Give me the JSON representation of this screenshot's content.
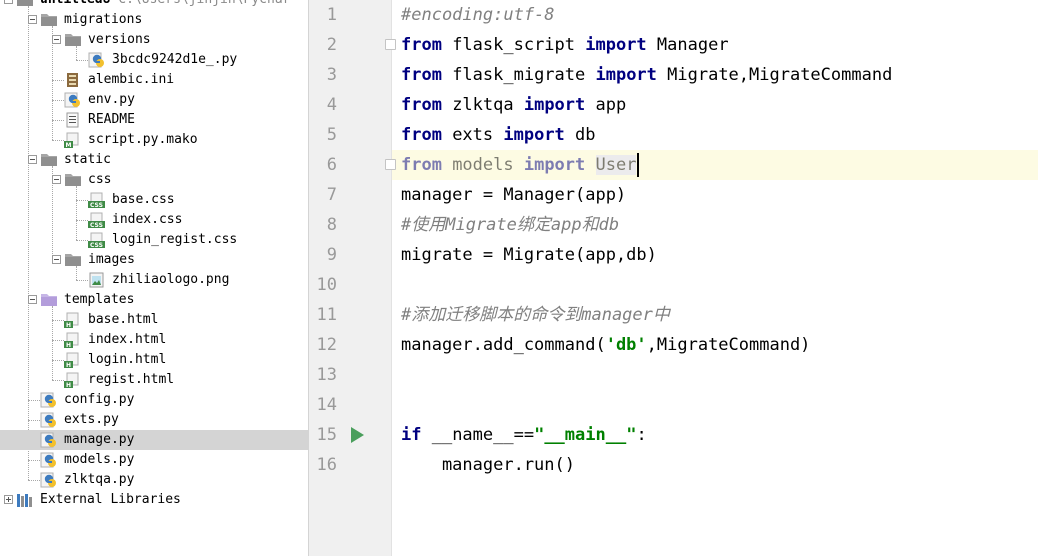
{
  "project": {
    "root_label": "untitled8",
    "root_path": "C:\\Users\\jinjin\\Pychar"
  },
  "tree": [
    {
      "key": "root",
      "label": "untitled8",
      "sublabel": "C:\\Users\\jinjin\\Pychar",
      "type": "folder",
      "depth": 0,
      "expander": "minus",
      "icon": "folder-icon"
    },
    {
      "key": "migrations",
      "label": "migrations",
      "type": "folder",
      "depth": 1,
      "expander": "minus",
      "icon": "folder-icon"
    },
    {
      "key": "versions",
      "label": "versions",
      "type": "folder",
      "depth": 2,
      "expander": "minus",
      "icon": "folder-icon"
    },
    {
      "key": "version-file",
      "label": "3bcdc9242d1e_.py",
      "type": "file",
      "depth": 3,
      "icon": "python-file-icon"
    },
    {
      "key": "alembic-ini",
      "label": "alembic.ini",
      "type": "file",
      "depth": 2,
      "icon": "ini-file-icon"
    },
    {
      "key": "env-py",
      "label": "env.py",
      "type": "file",
      "depth": 2,
      "icon": "python-file-icon"
    },
    {
      "key": "readme",
      "label": "README",
      "type": "file",
      "depth": 2,
      "icon": "text-file-icon"
    },
    {
      "key": "script-mako",
      "label": "script.py.mako",
      "type": "file",
      "depth": 2,
      "icon": "mako-file-icon"
    },
    {
      "key": "static",
      "label": "static",
      "type": "folder",
      "depth": 1,
      "expander": "minus",
      "icon": "folder-icon"
    },
    {
      "key": "css",
      "label": "css",
      "type": "folder",
      "depth": 2,
      "expander": "minus",
      "icon": "folder-icon"
    },
    {
      "key": "base-css",
      "label": "base.css",
      "type": "file",
      "depth": 3,
      "icon": "css-file-icon"
    },
    {
      "key": "index-css",
      "label": "index.css",
      "type": "file",
      "depth": 3,
      "icon": "css-file-icon"
    },
    {
      "key": "login-regist-css",
      "label": "login_regist.css",
      "type": "file",
      "depth": 3,
      "icon": "css-file-icon"
    },
    {
      "key": "images",
      "label": "images",
      "type": "folder",
      "depth": 2,
      "expander": "minus",
      "icon": "folder-icon"
    },
    {
      "key": "logo-png",
      "label": "zhiliaologo.png",
      "type": "file",
      "depth": 3,
      "icon": "image-file-icon"
    },
    {
      "key": "templates",
      "label": "templates",
      "type": "folder",
      "depth": 1,
      "expander": "minus",
      "icon": "templates-folder-icon"
    },
    {
      "key": "base-html",
      "label": "base.html",
      "type": "file",
      "depth": 2,
      "icon": "html-file-icon"
    },
    {
      "key": "index-html",
      "label": "index.html",
      "type": "file",
      "depth": 2,
      "icon": "html-file-icon"
    },
    {
      "key": "login-html",
      "label": "login.html",
      "type": "file",
      "depth": 2,
      "icon": "html-file-icon"
    },
    {
      "key": "regist-html",
      "label": "regist.html",
      "type": "file",
      "depth": 2,
      "icon": "html-file-icon"
    },
    {
      "key": "config-py",
      "label": "config.py",
      "type": "file",
      "depth": 1,
      "icon": "python-file-icon"
    },
    {
      "key": "exts-py",
      "label": "exts.py",
      "type": "file",
      "depth": 1,
      "icon": "python-file-icon"
    },
    {
      "key": "manage-py",
      "label": "manage.py",
      "type": "file",
      "depth": 1,
      "icon": "python-file-icon",
      "selected": true
    },
    {
      "key": "models-py",
      "label": "models.py",
      "type": "file",
      "depth": 1,
      "icon": "python-file-icon"
    },
    {
      "key": "zlktqa-py",
      "label": "zlktqa.py",
      "type": "file",
      "depth": 1,
      "icon": "python-file-icon"
    },
    {
      "key": "external-libs",
      "label": "External Libraries",
      "type": "library",
      "depth": 0,
      "expander": "plus",
      "icon": "libraries-icon"
    }
  ],
  "editor": {
    "current_line": 6,
    "lines": [
      {
        "n": "1",
        "tokens": [
          {
            "t": "#encoding:utf-8",
            "c": "cm"
          }
        ]
      },
      {
        "n": "2",
        "fold": true,
        "tokens": [
          {
            "t": "from",
            "c": "kw"
          },
          {
            "t": " flask_script "
          },
          {
            "t": "import",
            "c": "kw"
          },
          {
            "t": " Manager"
          }
        ]
      },
      {
        "n": "3",
        "tokens": [
          {
            "t": "from",
            "c": "kw"
          },
          {
            "t": " flask_migrate "
          },
          {
            "t": "import",
            "c": "kw"
          },
          {
            "t": " Migrate,MigrateCommand"
          }
        ]
      },
      {
        "n": "4",
        "tokens": [
          {
            "t": "from",
            "c": "kw"
          },
          {
            "t": " zlktqa "
          },
          {
            "t": "import",
            "c": "kw"
          },
          {
            "t": " app"
          }
        ]
      },
      {
        "n": "5",
        "tokens": [
          {
            "t": "from",
            "c": "kw"
          },
          {
            "t": " exts "
          },
          {
            "t": "import",
            "c": "kw"
          },
          {
            "t": " db"
          }
        ]
      },
      {
        "n": "6",
        "fold": true,
        "tokens": [
          {
            "t": "from",
            "c": "kw dim"
          },
          {
            "t": " models ",
            "c": "dim"
          },
          {
            "t": "import",
            "c": "kw dim"
          },
          {
            "t": " "
          },
          {
            "t": "User",
            "c": "dim hl"
          },
          {
            "caret": true
          }
        ]
      },
      {
        "n": "7",
        "tokens": [
          {
            "t": "manager = Manager(app)"
          }
        ]
      },
      {
        "n": "8",
        "tokens": [
          {
            "t": "#使用Migrate绑定app和db",
            "c": "cm"
          }
        ]
      },
      {
        "n": "9",
        "tokens": [
          {
            "t": "migrate = Migrate(app,db)"
          }
        ]
      },
      {
        "n": "10",
        "tokens": []
      },
      {
        "n": "11",
        "tokens": [
          {
            "t": "#添加迁移脚本的命令到manager中",
            "c": "cm"
          }
        ]
      },
      {
        "n": "12",
        "tokens": [
          {
            "t": "manager.add_command("
          },
          {
            "t": "'db'",
            "c": "str"
          },
          {
            "t": ",MigrateCommand)"
          }
        ]
      },
      {
        "n": "13",
        "tokens": []
      },
      {
        "n": "14",
        "tokens": []
      },
      {
        "n": "15",
        "run": true,
        "tokens": [
          {
            "t": "if",
            "c": "kw"
          },
          {
            "t": " __name__=="
          },
          {
            "t": "\"__main__\"",
            "c": "str"
          },
          {
            "t": ":"
          }
        ]
      },
      {
        "n": "16",
        "tokens": [
          {
            "t": "    manager.run()"
          }
        ]
      }
    ]
  },
  "colors": {
    "keyword": "#000080",
    "comment": "#808080",
    "string": "#008000",
    "gutter": "#f0f0f0",
    "current_line": "#fdfbe3",
    "selection": "#d4d4d4",
    "run_marker": "#4a9e5c"
  }
}
